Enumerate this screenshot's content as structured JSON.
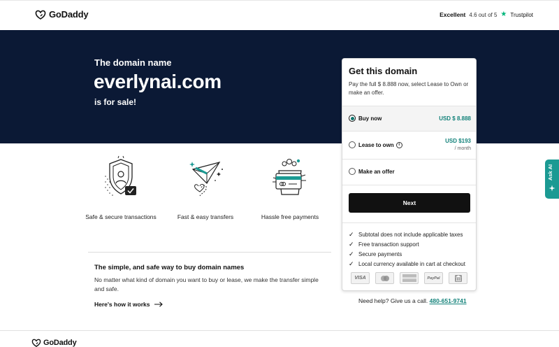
{
  "header": {
    "logo_text": "GoDaddy",
    "trust_label": "Excellent",
    "trust_score": "4.6 out of 5",
    "trust_brand": "Trustpilot"
  },
  "hero": {
    "line1": "The domain name",
    "domain": "everlynai.com",
    "line3": "is for sale!"
  },
  "features": [
    {
      "label": "Safe & secure transactions",
      "icon": "shield-icon"
    },
    {
      "label": "Fast & easy transfers",
      "icon": "paper-plane-icon"
    },
    {
      "label": "Hassle free payments",
      "icon": "payment-card-icon"
    }
  ],
  "info": {
    "title": "The simple, and safe way to buy domain names",
    "body": "No matter what kind of domain you want to buy or lease, we make the transfer simple and safe.",
    "link": "Here's how it works"
  },
  "card": {
    "title": "Get this domain",
    "description": "Pay the full $ 8.888 now, select Lease to Own or make an offer.",
    "options": [
      {
        "label": "Buy now",
        "price": "USD $ 8.888",
        "sub": "",
        "selected": true
      },
      {
        "label": "Lease to own",
        "price": "USD $193",
        "sub": "/ month",
        "selected": false
      },
      {
        "label": "Make an offer",
        "price": "",
        "sub": "",
        "selected": false
      }
    ],
    "next_label": "Next",
    "checks": [
      "Subtotal does not include applicable taxes",
      "Free transaction support",
      "Secure payments",
      "Local currency available in cart at checkout"
    ],
    "payments": [
      "VISA",
      "mastercard",
      "amex",
      "PayPal",
      "bank"
    ]
  },
  "help": {
    "text": "Need help? Give us a call.",
    "phone": "480-651-9741"
  },
  "ask_ai": "Ask AI",
  "footer": {
    "logo_text": "GoDaddy"
  },
  "colors": {
    "hero_bg": "#0b1935",
    "accent": "#13827a",
    "ask_ai_bg": "#1b9a93",
    "trustpilot_green": "#00b67a"
  }
}
